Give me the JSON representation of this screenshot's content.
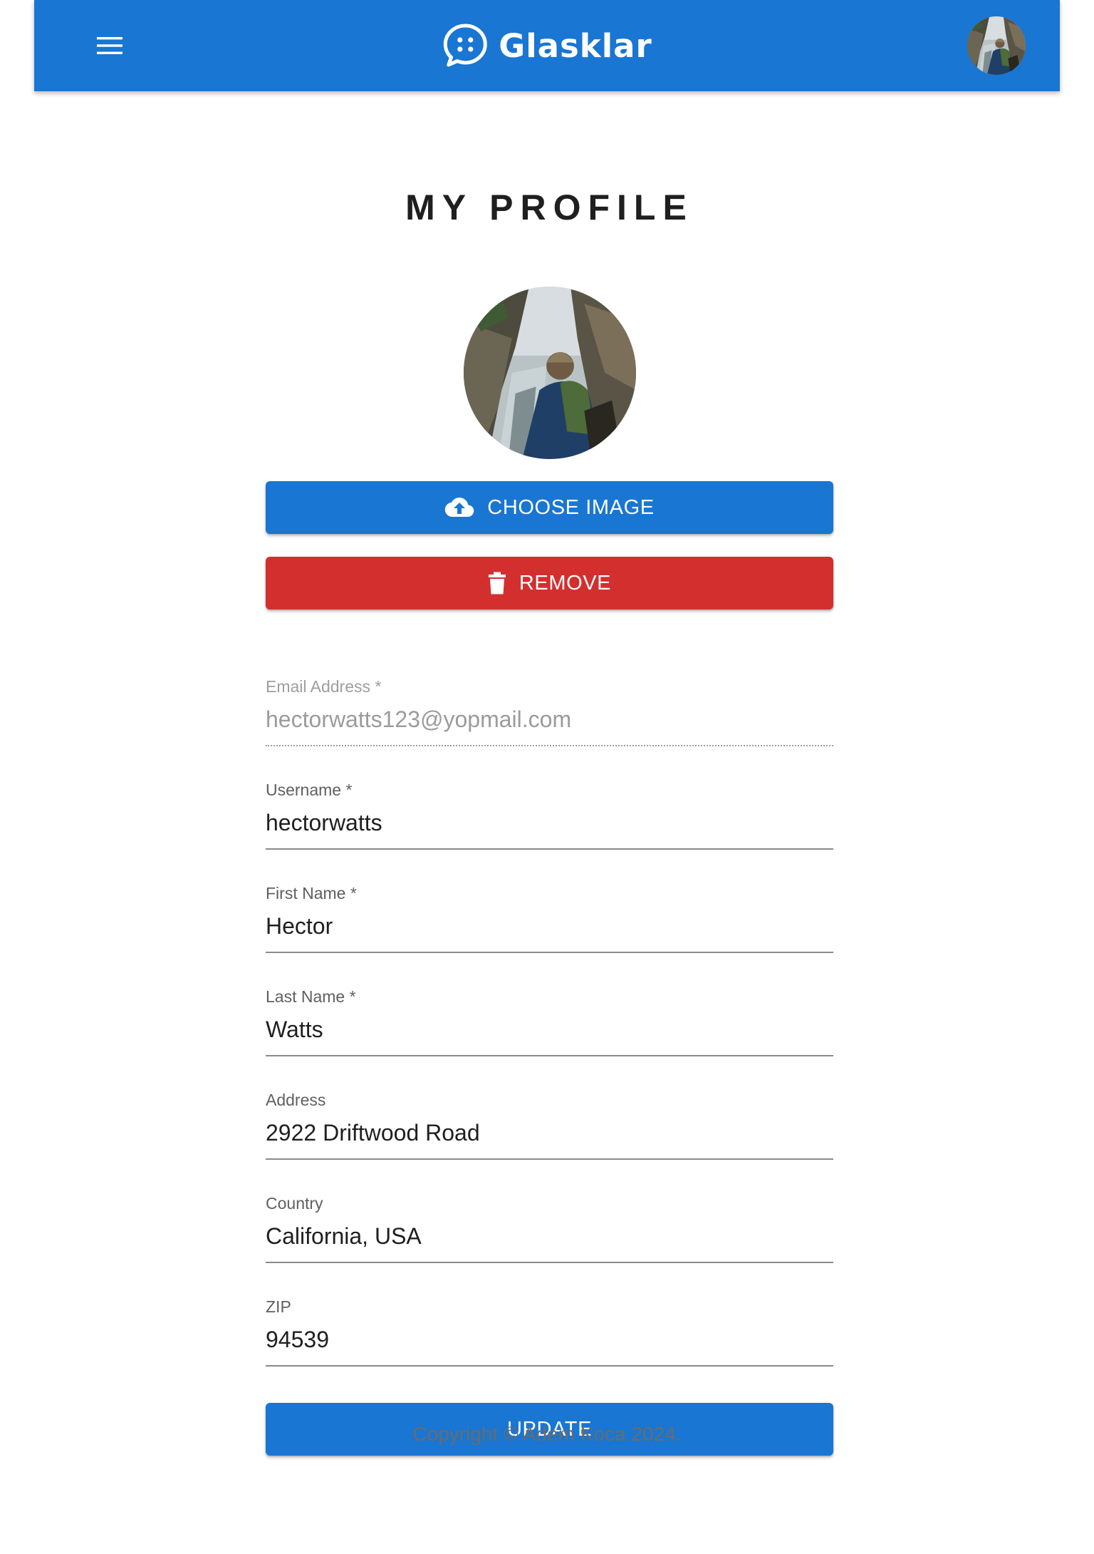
{
  "header": {
    "brand": "Glasklar",
    "menu_icon": "menu-icon",
    "logo_icon": "chat-bubble-icon",
    "brand_color": "#1976d2"
  },
  "main": {
    "title": "MY PROFILE",
    "choose_image_label": "CHOOSE IMAGE",
    "choose_image_icon": "cloud-upload-icon",
    "remove_label": "REMOVE",
    "remove_icon": "trash-icon",
    "remove_color": "#d32f2f",
    "update_label": "UPDATE",
    "fields": {
      "email": {
        "label": "Email Address *",
        "value": "hectorwatts123@yopmail.com",
        "disabled": true
      },
      "username": {
        "label": "Username *",
        "value": "hectorwatts"
      },
      "first_name": {
        "label": "First Name *",
        "value": "Hector"
      },
      "last_name": {
        "label": "Last Name *",
        "value": "Watts"
      },
      "address": {
        "label": "Address",
        "value": "2922 Driftwood Road"
      },
      "country": {
        "label": "Country",
        "value": "California, USA"
      },
      "zip": {
        "label": "ZIP",
        "value": "94539"
      }
    }
  },
  "footer": {
    "copyright": "Copyright © Adem Koca 2024."
  }
}
